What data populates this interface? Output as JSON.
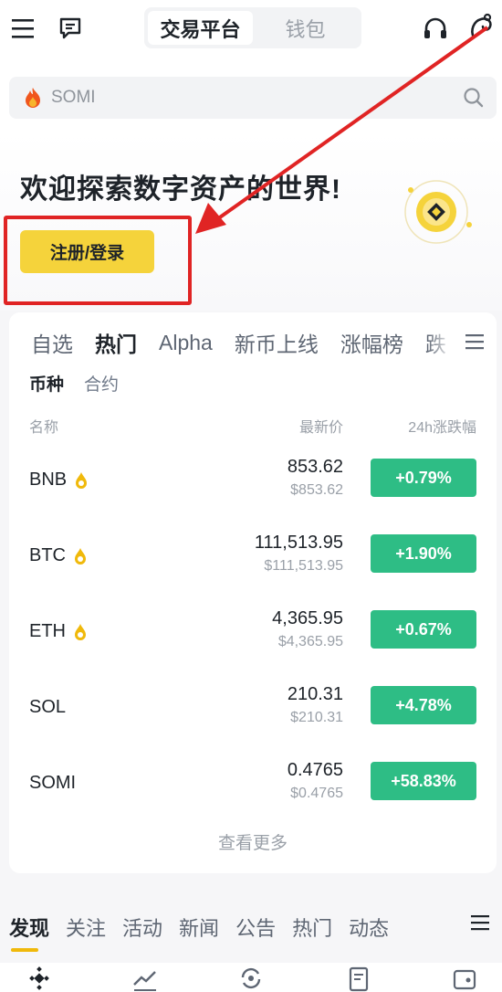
{
  "top_bar": {
    "tabs": [
      {
        "label": "交易平台",
        "active": true
      },
      {
        "label": "钱包",
        "active": false
      }
    ],
    "icons": [
      "menu-icon",
      "chat-icon",
      "headset-icon",
      "gift-icon"
    ]
  },
  "search": {
    "placeholder": "SOMI",
    "icon": "search-icon"
  },
  "hero": {
    "welcome_text": "欢迎探索数字资产的世界!",
    "register_label": "注册/登录"
  },
  "market": {
    "tabs": [
      "自选",
      "热门",
      "Alpha",
      "新币上线",
      "涨幅榜",
      "跌"
    ],
    "active_tab": "热门",
    "subtabs": [
      "币种",
      "合约"
    ],
    "active_subtab": "币种",
    "columns": {
      "name": "名称",
      "price": "最新价",
      "change": "24h涨跌幅"
    },
    "rows": [
      {
        "symbol": "BNB",
        "hot": true,
        "price": "853.62",
        "price_usd": "$853.62",
        "change": "+0.79%"
      },
      {
        "symbol": "BTC",
        "hot": true,
        "price": "111,513.95",
        "price_usd": "$111,513.95",
        "change": "+1.90%"
      },
      {
        "symbol": "ETH",
        "hot": true,
        "price": "4,365.95",
        "price_usd": "$4,365.95",
        "change": "+0.67%"
      },
      {
        "symbol": "SOL",
        "hot": false,
        "price": "210.31",
        "price_usd": "$210.31",
        "change": "+4.78%"
      },
      {
        "symbol": "SOMI",
        "hot": false,
        "price": "0.4765",
        "price_usd": "$0.4765",
        "change": "+58.83%"
      }
    ],
    "view_more": "查看更多"
  },
  "feed_tabs": {
    "tabs": [
      "发现",
      "关注",
      "活动",
      "新闻",
      "公告",
      "热门",
      "动态"
    ],
    "active": "发现"
  },
  "colors": {
    "brand_yellow": "#F5D33B",
    "up_green": "#2EBD85",
    "annotation_red": "#E02424"
  }
}
